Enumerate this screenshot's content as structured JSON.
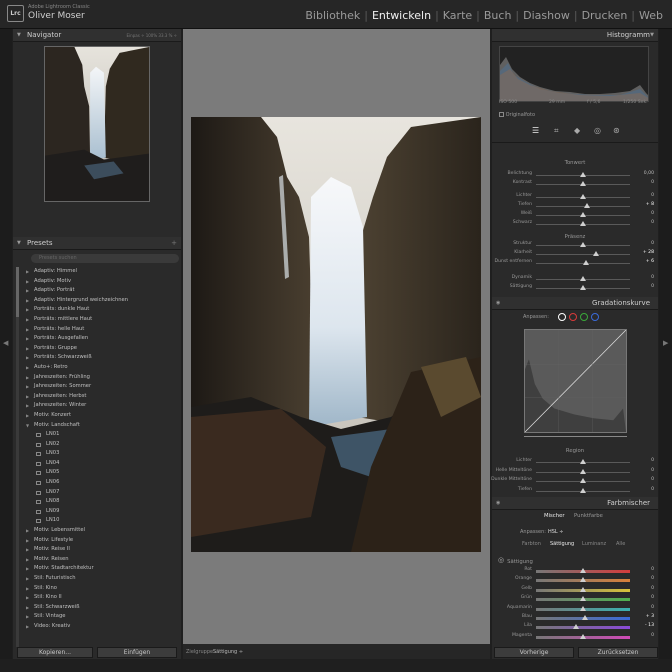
{
  "app": {
    "logo": "Lrc",
    "product": "Adobe Lightroom Classic",
    "user": "Oliver Moser"
  },
  "modules": [
    {
      "label": "Bibliothek",
      "active": false
    },
    {
      "label": "Entwickeln",
      "active": true
    },
    {
      "label": "Karte",
      "active": false
    },
    {
      "label": "Buch",
      "active": false
    },
    {
      "label": "Diashow",
      "active": false
    },
    {
      "label": "Drucken",
      "active": false
    },
    {
      "label": "Web",
      "active": false
    }
  ],
  "navigator": {
    "title": "Navigator",
    "zoom_options": "Einpas ÷  100%  33.3 % ÷"
  },
  "presets": {
    "title": "Presets",
    "search_placeholder": "Presets suchen",
    "items": [
      {
        "label": "Adaptiv: Himmel",
        "type": "folder",
        "open": false
      },
      {
        "label": "Adaptiv: Motiv",
        "type": "folder",
        "open": false
      },
      {
        "label": "Adaptiv: Porträt",
        "type": "folder",
        "open": false
      },
      {
        "label": "Adaptiv: Hintergrund weichzeichnen",
        "type": "folder",
        "open": false
      },
      {
        "label": "Porträts: dunkle Haut",
        "type": "folder",
        "open": false
      },
      {
        "label": "Porträts: mittlere Haut",
        "type": "folder",
        "open": false
      },
      {
        "label": "Porträts: helle Haut",
        "type": "folder",
        "open": false
      },
      {
        "label": "Porträts: Ausgefallen",
        "type": "folder",
        "open": false
      },
      {
        "label": "Porträts: Gruppe",
        "type": "folder",
        "open": false
      },
      {
        "label": "Porträts: Schwarzweiß",
        "type": "folder",
        "open": false
      },
      {
        "label": "Auto+: Retro",
        "type": "folder",
        "open": false
      },
      {
        "label": "Jahreszeiten: Frühling",
        "type": "folder",
        "open": false
      },
      {
        "label": "Jahreszeiten: Sommer",
        "type": "folder",
        "open": false
      },
      {
        "label": "Jahreszeiten: Herbst",
        "type": "folder",
        "open": false
      },
      {
        "label": "Jahreszeiten: Winter",
        "type": "folder",
        "open": false
      },
      {
        "label": "Motiv: Konzert",
        "type": "folder",
        "open": false
      },
      {
        "label": "Motiv: Landschaft",
        "type": "folder",
        "open": true
      },
      {
        "label": "LN01",
        "type": "preset"
      },
      {
        "label": "LN02",
        "type": "preset"
      },
      {
        "label": "LN03",
        "type": "preset"
      },
      {
        "label": "LN04",
        "type": "preset"
      },
      {
        "label": "LN05",
        "type": "preset"
      },
      {
        "label": "LN06",
        "type": "preset"
      },
      {
        "label": "LN07",
        "type": "preset"
      },
      {
        "label": "LN08",
        "type": "preset"
      },
      {
        "label": "LN09",
        "type": "preset"
      },
      {
        "label": "LN10",
        "type": "preset"
      },
      {
        "label": "Motiv: Lebensmittel",
        "type": "folder",
        "open": false
      },
      {
        "label": "Motiv: Lifestyle",
        "type": "folder",
        "open": false
      },
      {
        "label": "Motiv: Reise II",
        "type": "folder",
        "open": false
      },
      {
        "label": "Motiv: Reisen",
        "type": "folder",
        "open": false
      },
      {
        "label": "Motiv: Stadtarchitektur",
        "type": "folder",
        "open": false
      },
      {
        "label": "Stil: Futuristisch",
        "type": "folder",
        "open": false
      },
      {
        "label": "Stil: Kino",
        "type": "folder",
        "open": false
      },
      {
        "label": "Stil: Kino II",
        "type": "folder",
        "open": false
      },
      {
        "label": "Stil: Schwarzweiß",
        "type": "folder",
        "open": false
      },
      {
        "label": "Stil: Vintage",
        "type": "folder",
        "open": false
      },
      {
        "label": "Video: Kreativ",
        "type": "folder",
        "open": false
      }
    ]
  },
  "buttons": {
    "copy": "Kopieren...",
    "paste": "Einfügen",
    "previous": "Vorherige",
    "reset": "Zurücksetzen"
  },
  "toolbar": {
    "label": "Zielgruppe:",
    "value": "Sättigung ÷"
  },
  "histogram": {
    "title": "Histogramm",
    "iso": "ISO 500",
    "focal": "29 mm",
    "aperture": "f / 5,6",
    "shutter": "1/250 Sek.",
    "original_label": "Originalfoto"
  },
  "tonwert": {
    "title": "Tonwert",
    "rows": [
      {
        "label": "Belichtung",
        "value": "0,00",
        "pos": 0.5
      },
      {
        "label": "Kontrast",
        "value": "0",
        "pos": 0.5
      },
      {
        "label": "Lichter",
        "value": "0",
        "pos": 0.5
      },
      {
        "label": "Tiefen",
        "value": "+ 8",
        "pos": 0.54
      },
      {
        "label": "Weiß",
        "value": "0",
        "pos": 0.5
      },
      {
        "label": "Schwarz",
        "value": "0",
        "pos": 0.5
      }
    ]
  },
  "praesenz": {
    "title": "Präsenz",
    "rows": [
      {
        "label": "Struktur",
        "value": "0",
        "pos": 0.5
      },
      {
        "label": "Klarheit",
        "value": "+ 28",
        "pos": 0.64
      },
      {
        "label": "Dunst entfernen",
        "value": "+ 6",
        "pos": 0.53
      },
      {
        "label": "Dynamik",
        "value": "0",
        "pos": 0.5
      },
      {
        "label": "Sättigung",
        "value": "0",
        "pos": 0.5
      }
    ]
  },
  "gradation": {
    "title": "Gradationskurve",
    "adjust_label": "Anpassen:",
    "region_title": "Region",
    "rows": [
      {
        "label": "Lichter",
        "value": "0",
        "pos": 0.5
      },
      {
        "label": "Helle Mitteltöne",
        "value": "0",
        "pos": 0.5
      },
      {
        "label": "Dunkle Mitteltöne",
        "value": "0",
        "pos": 0.5
      },
      {
        "label": "Tiefen",
        "value": "0",
        "pos": 0.5
      }
    ],
    "channel_colors": [
      "#ffffff",
      "#d83a3a",
      "#3aa83a",
      "#3a6ad8"
    ]
  },
  "farbmischer": {
    "title": "Farbmischer",
    "tab_mixer": "Mischer",
    "tab_point": "Punktfarbe",
    "adjust_label": "Anpassen:",
    "adjust_value": "HSL ÷",
    "hsl_tabs": [
      "Farbton",
      "Sättigung",
      "Luminanz",
      "Alle"
    ],
    "active_hsl": "Sättigung",
    "section": "Sättigung",
    "rows": [
      {
        "label": "Rot",
        "value": "0",
        "pos": 0.5,
        "color": "#d43c3c"
      },
      {
        "label": "Orange",
        "value": "0",
        "pos": 0.5,
        "color": "#d8803a"
      },
      {
        "label": "Gelb",
        "value": "0",
        "pos": 0.5,
        "color": "#d8c23a"
      },
      {
        "label": "Grün",
        "value": "0",
        "pos": 0.5,
        "color": "#4fb04f"
      },
      {
        "label": "Aquamarin",
        "value": "0",
        "pos": 0.5,
        "color": "#3ab0b0"
      },
      {
        "label": "Blau",
        "value": "+ 3",
        "pos": 0.52,
        "color": "#3a6ad8"
      },
      {
        "label": "Lila",
        "value": "- 13",
        "pos": 0.43,
        "color": "#8a4ad8"
      },
      {
        "label": "Magenta",
        "value": "0",
        "pos": 0.5,
        "color": "#d04ab8"
      }
    ]
  }
}
